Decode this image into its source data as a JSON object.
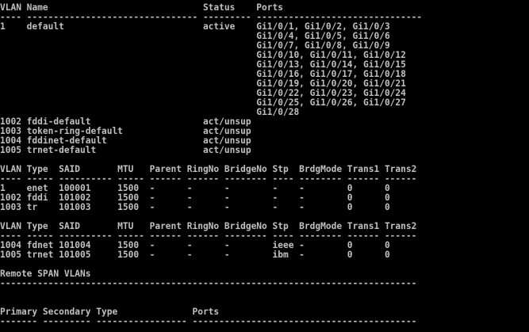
{
  "colors": {
    "background": "#000000",
    "foreground": "#c0c0c0"
  },
  "terminal": {
    "lines": [
      "VLAN Name                             Status    Ports",
      "---- -------------------------------- --------- -------------------------------",
      "1    default                          active    Gi1/0/1, Gi1/0/2, Gi1/0/3",
      "                                                Gi1/0/4, Gi1/0/5, Gi1/0/6",
      "                                                Gi1/0/7, Gi1/0/8, Gi1/0/9",
      "                                                Gi1/0/10, Gi1/0/11, Gi1/0/12",
      "                                                Gi1/0/13, Gi1/0/14, Gi1/0/15",
      "                                                Gi1/0/16, Gi1/0/17, Gi1/0/18",
      "                                                Gi1/0/19, Gi1/0/20, Gi1/0/21",
      "                                                Gi1/0/22, Gi1/0/23, Gi1/0/24",
      "                                                Gi1/0/25, Gi1/0/26, Gi1/0/27",
      "                                                Gi1/0/28",
      "1002 fddi-default                     act/unsup",
      "1003 token-ring-default               act/unsup",
      "1004 fddinet-default                  act/unsup",
      "1005 trnet-default                    act/unsup",
      "",
      "VLAN Type  SAID       MTU   Parent RingNo BridgeNo Stp  BrdgMode Trans1 Trans2",
      "---- ----- ---------- ----- ------ ------ -------- ---- -------- ------ ------",
      "1    enet  100001     1500  -      -      -        -    -        0      0",
      "1002 fddi  101002     1500  -      -      -        -    -        0      0",
      "1003 tr    101003     1500  -      -      -        -    -        0      0",
      "",
      "VLAN Type  SAID       MTU   Parent RingNo BridgeNo Stp  BrdgMode Trans1 Trans2",
      "---- ----- ---------- ----- ------ ------ -------- ---- -------- ------ ------",
      "1004 fdnet 101004     1500  -      -      -        ieee -        0      0",
      "1005 trnet 101005     1500  -      -      -        ibm  -        0      0",
      "",
      "Remote SPAN VLANs",
      "------------------------------------------------------------------------------",
      "",
      "",
      "Primary Secondary Type              Ports",
      "------- --------- ----------------- ------------------------------------------"
    ]
  }
}
